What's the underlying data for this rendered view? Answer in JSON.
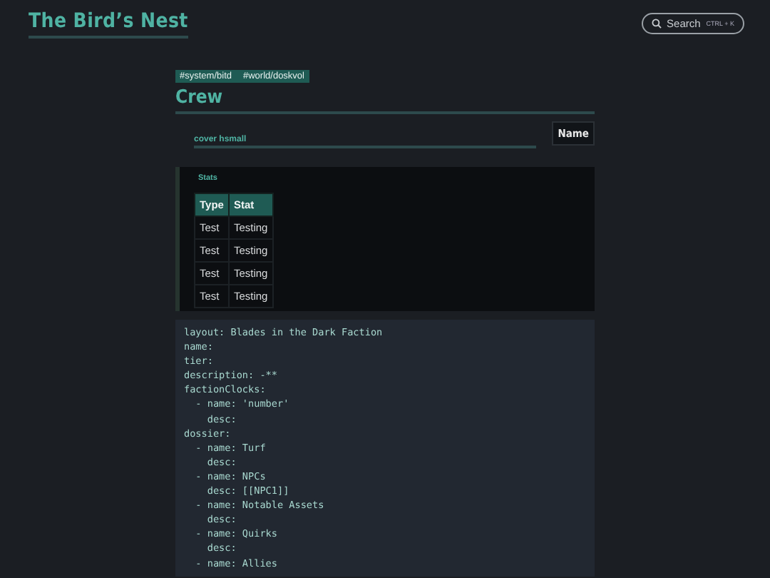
{
  "site_title": "The Bird’s Nest",
  "search": {
    "label": "Search",
    "shortcut": "CTRL + K"
  },
  "tags": [
    "#system/bitd",
    "#world/doskvol"
  ],
  "title": "Crew",
  "cover": {
    "label": "cover hsmall"
  },
  "name_button": "Name",
  "stats": {
    "heading": "Stats",
    "columns": [
      "Type",
      "Stat"
    ],
    "rows": [
      [
        "Test",
        "Testing"
      ],
      [
        "Test",
        "Testing"
      ],
      [
        "Test",
        "Testing"
      ],
      [
        "Test",
        "Testing"
      ]
    ]
  },
  "code_lines": [
    "layout: Blades in the Dark Faction",
    "name:",
    "tier:",
    "description: -**",
    "factionClocks:",
    "  - name: 'number'",
    "    desc:",
    "dossier:",
    "  - name: Turf",
    "    desc:",
    "  - name: NPCs",
    "    desc: [[NPC1]]",
    "  - name: Notable Assets",
    "    desc:",
    "  - name: Quirks",
    "    desc:",
    "  - name: Allies"
  ]
}
